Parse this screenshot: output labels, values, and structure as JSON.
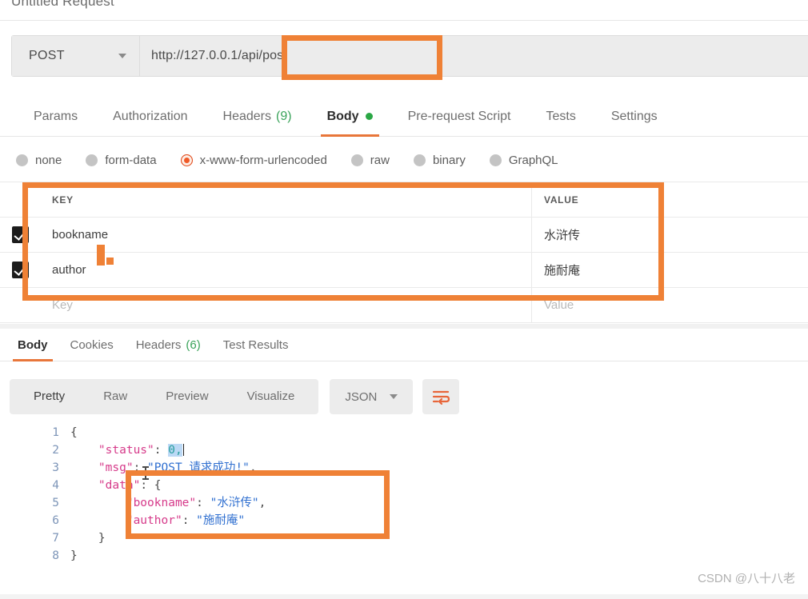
{
  "request": {
    "title": "Untitled Request",
    "method": "POST",
    "url": "http://127.0.0.1/api/post",
    "method_caret_icon": "chevron-down-icon"
  },
  "request_tabs": [
    {
      "label": "Params",
      "active": false
    },
    {
      "label": "Authorization",
      "active": false
    },
    {
      "label": "Headers",
      "count": "(9)",
      "active": false
    },
    {
      "label": "Body",
      "active": true,
      "dot": true
    },
    {
      "label": "Pre-request Script",
      "active": false
    },
    {
      "label": "Tests",
      "active": false
    },
    {
      "label": "Settings",
      "active": false
    }
  ],
  "body_types": [
    {
      "label": "none",
      "selected": false
    },
    {
      "label": "form-data",
      "selected": false
    },
    {
      "label": "x-www-form-urlencoded",
      "selected": true
    },
    {
      "label": "raw",
      "selected": false
    },
    {
      "label": "binary",
      "selected": false
    },
    {
      "label": "GraphQL",
      "selected": false
    }
  ],
  "kv_table": {
    "header": {
      "key": "KEY",
      "value": "VALUE"
    },
    "rows": [
      {
        "checked": true,
        "key": "bookname",
        "value": "水浒传"
      },
      {
        "checked": true,
        "key": "author",
        "value": "施耐庵"
      }
    ],
    "placeholder_row": {
      "key": "Key",
      "value": "Value"
    }
  },
  "response_tabs": [
    {
      "label": "Body",
      "active": true
    },
    {
      "label": "Cookies",
      "active": false
    },
    {
      "label": "Headers",
      "count": "(6)",
      "active": false
    },
    {
      "label": "Test Results",
      "active": false
    }
  ],
  "viewer": {
    "formats": [
      {
        "label": "Pretty",
        "active": true
      },
      {
        "label": "Raw",
        "active": false
      },
      {
        "label": "Preview",
        "active": false
      },
      {
        "label": "Visualize",
        "active": false
      }
    ],
    "language": "JSON",
    "language_caret_icon": "chevron-down-icon",
    "wrap_icon": "wrap-text-icon"
  },
  "response_body": {
    "lines": [
      {
        "no": "1",
        "text": "{"
      },
      {
        "no": "2",
        "text": "    \"status\": 0,"
      },
      {
        "no": "3",
        "text": "    \"msg\": \"POST 请求成功!\","
      },
      {
        "no": "4",
        "text": "    \"data\": {"
      },
      {
        "no": "5",
        "text": "        \"bookname\": \"水浒传\","
      },
      {
        "no": "6",
        "text": "        \"author\": \"施耐庵\""
      },
      {
        "no": "7",
        "text": "    }"
      },
      {
        "no": "8",
        "text": "}"
      }
    ]
  },
  "annotations": {
    "color": "#ef8136",
    "boxes": [
      "url-suffix",
      "key-value-table",
      "json-data-object"
    ]
  },
  "watermark": "CSDN @八十八老"
}
